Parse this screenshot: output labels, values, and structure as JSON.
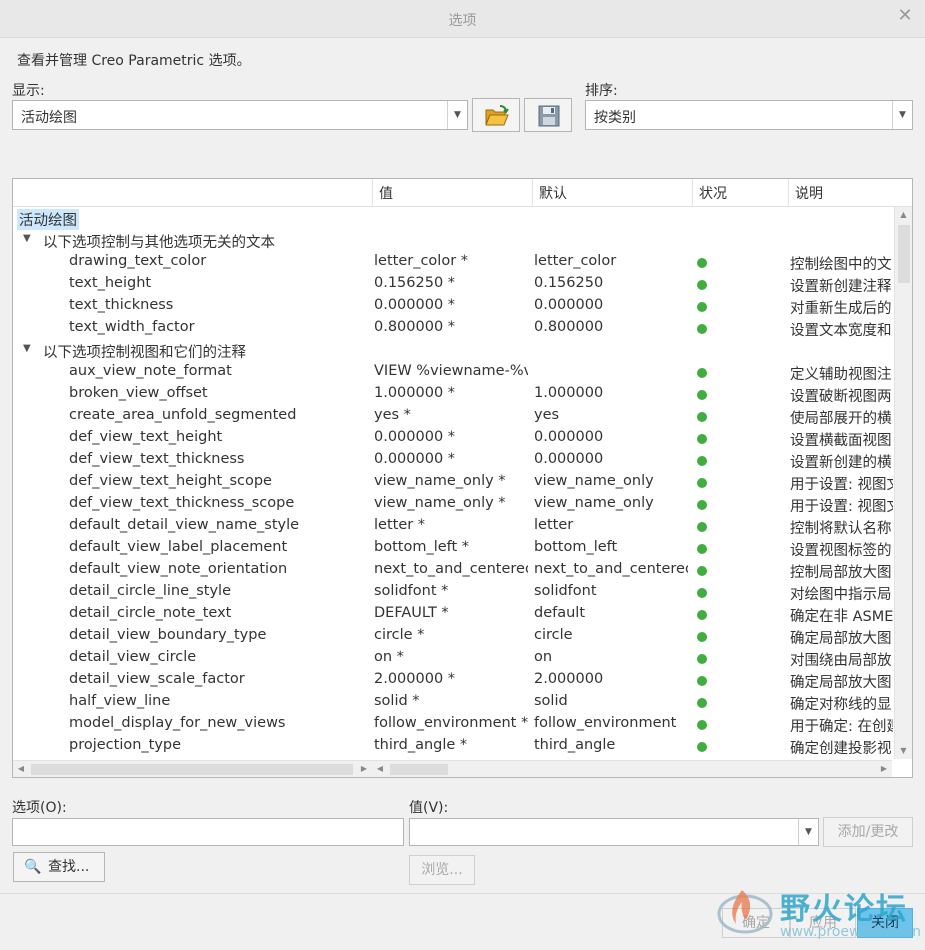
{
  "window": {
    "title": "选项"
  },
  "description": "查看并管理 Creo Parametric 选项。",
  "display": {
    "label": "显示:",
    "value": "活动绘图"
  },
  "sort": {
    "label": "排序:",
    "value": "按类别"
  },
  "grid": {
    "columns": [
      "值",
      "默认",
      "状况",
      "说明"
    ],
    "root": "活动绘图",
    "categories": [
      "以下选项控制与其他选项无关的文本",
      "以下选项控制视图和它们的注释"
    ],
    "rows": [
      {
        "name": "drawing_text_color",
        "value": "letter_color *",
        "default": "letter_color",
        "desc": "控制绘图中的文"
      },
      {
        "name": "text_height",
        "value": "0.156250 *",
        "default": "0.156250",
        "desc": "设置新创建注释"
      },
      {
        "name": "text_thickness",
        "value": "0.000000 *",
        "default": "0.000000",
        "desc": "对重新生成后的"
      },
      {
        "name": "text_width_factor",
        "value": "0.800000 *",
        "default": "0.800000",
        "desc": "设置文本宽度和"
      },
      {
        "name": "aux_view_note_format",
        "value": "VIEW %viewname-%vi",
        "default": "",
        "desc": "定义辅助视图注"
      },
      {
        "name": "broken_view_offset",
        "value": "1.000000 *",
        "default": "1.000000",
        "desc": "设置破断视图两"
      },
      {
        "name": "create_area_unfold_segmented",
        "value": "yes *",
        "default": "yes",
        "desc": "使局部展开的横"
      },
      {
        "name": "def_view_text_height",
        "value": "0.000000 *",
        "default": "0.000000",
        "desc": "设置横截面视图"
      },
      {
        "name": "def_view_text_thickness",
        "value": "0.000000 *",
        "default": "0.000000",
        "desc": "设置新创建的横"
      },
      {
        "name": "def_view_text_height_scope",
        "value": "view_name_only *",
        "default": "view_name_only",
        "desc": "用于设置: 视图文"
      },
      {
        "name": "def_view_text_thickness_scope",
        "value": "view_name_only *",
        "default": "view_name_only",
        "desc": "用于设置: 视图文"
      },
      {
        "name": "default_detail_view_name_style",
        "value": "letter *",
        "default": "letter",
        "desc": "控制将默认名称"
      },
      {
        "name": "default_view_label_placement",
        "value": "bottom_left *",
        "default": "bottom_left",
        "desc": "设置视图标签的"
      },
      {
        "name": "default_view_note_orientation",
        "value": "next_to_and_centered",
        "default": "next_to_and_centered",
        "desc": "控制局部放大图"
      },
      {
        "name": "detail_circle_line_style",
        "value": "solidfont *",
        "default": "solidfont",
        "desc": "对绘图中指示局"
      },
      {
        "name": "detail_circle_note_text",
        "value": "DEFAULT *",
        "default": "default",
        "desc": "确定在非 ASME"
      },
      {
        "name": "detail_view_boundary_type",
        "value": "circle *",
        "default": "circle",
        "desc": "确定局部放大图"
      },
      {
        "name": "detail_view_circle",
        "value": "on *",
        "default": "on",
        "desc": "对围绕由局部放"
      },
      {
        "name": "detail_view_scale_factor",
        "value": "2.000000 *",
        "default": "2.000000",
        "desc": "确定局部放大图"
      },
      {
        "name": "half_view_line",
        "value": "solid *",
        "default": "solid",
        "desc": "确定对称线的显"
      },
      {
        "name": "model_display_for_new_views",
        "value": "follow_environment *",
        "default": "follow_environment",
        "desc": "用于确定: 在创建"
      },
      {
        "name": "projection_type",
        "value": "third_angle *",
        "default": "third_angle",
        "desc": "确定创建投影视"
      }
    ]
  },
  "option_field": {
    "label": "选项(O):",
    "value": ""
  },
  "value_field": {
    "label": "值(V):",
    "value": ""
  },
  "buttons": {
    "add_change": "添加/更改",
    "find": "查找...",
    "browse": "浏览...",
    "ok": "确定",
    "apply": "应用",
    "close": "关闭"
  },
  "watermark": {
    "title": "野火论坛",
    "url": "www.proewildfire.cn"
  },
  "colors": {
    "status_ok": "#3fae3f",
    "selection": "#cce8ff",
    "primary_button": "#6cc3ec"
  }
}
